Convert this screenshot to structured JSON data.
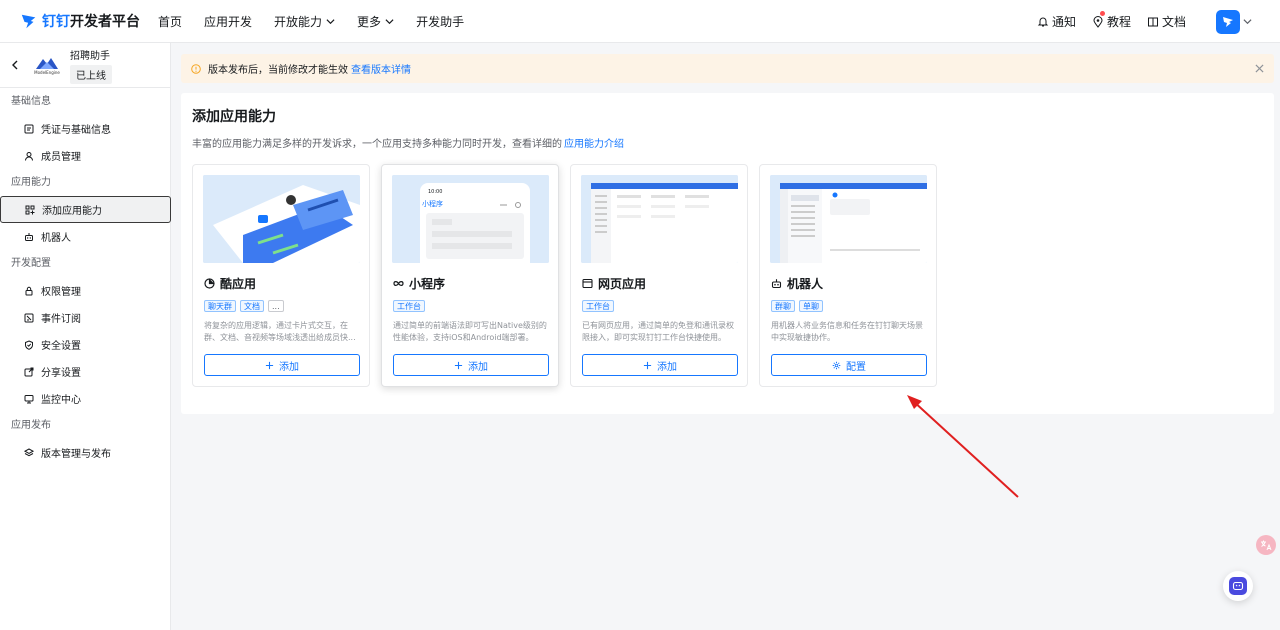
{
  "brand": {
    "name_part1": "钉钉",
    "name_part2": "开发者平台",
    "logo_icon": "dingtalk-logo-icon"
  },
  "nav": {
    "items": [
      {
        "label": "首页",
        "has_dropdown": false
      },
      {
        "label": "应用开发",
        "has_dropdown": false
      },
      {
        "label": "开放能力",
        "has_dropdown": true
      },
      {
        "label": "更多",
        "has_dropdown": true
      },
      {
        "label": "开发助手",
        "has_dropdown": false
      }
    ]
  },
  "top_right": {
    "notify_label": "通知",
    "tutorial_label": "教程",
    "docs_label": "文档"
  },
  "sidebar": {
    "app": {
      "name": "招聘助手",
      "status": "已上线",
      "logo_text": "ModelEngine"
    },
    "groups": [
      {
        "label": "基础信息",
        "items": [
          {
            "label": "凭证与基础信息",
            "icon": "list-icon"
          },
          {
            "label": "成员管理",
            "icon": "user-icon"
          }
        ]
      },
      {
        "label": "应用能力",
        "items": [
          {
            "label": "添加应用能力",
            "icon": "apps-icon",
            "active": true
          },
          {
            "label": "机器人",
            "icon": "robot-icon"
          }
        ]
      },
      {
        "label": "开发配置",
        "items": [
          {
            "label": "权限管理",
            "icon": "lock-icon"
          },
          {
            "label": "事件订阅",
            "icon": "event-icon"
          },
          {
            "label": "安全设置",
            "icon": "shield-icon"
          },
          {
            "label": "分享设置",
            "icon": "share-icon"
          },
          {
            "label": "监控中心",
            "icon": "monitor-icon"
          }
        ]
      },
      {
        "label": "应用发布",
        "items": [
          {
            "label": "版本管理与发布",
            "icon": "layers-icon"
          }
        ]
      }
    ]
  },
  "notice": {
    "text": "版本发布后，当前修改才能生效",
    "link": "查看版本详情"
  },
  "main": {
    "title": "添加应用能力",
    "desc": "丰富的应用能力满足多样的开发诉求，一个应用支持多种能力同时开发，查看详细的",
    "desc_link": "应用能力介绍",
    "cards": [
      {
        "title": "酷应用",
        "icon": "cool-app-icon",
        "tags": [
          "聊天群",
          "文档",
          "..."
        ],
        "desc": "将复杂的应用逻辑，通过卡片式交互，在群、文档、音视频等场域浅透出给成员快...",
        "button": "添加",
        "button_icon": "plus-icon"
      },
      {
        "title": "小程序",
        "icon": "mini-program-icon",
        "tags": [
          "工作台"
        ],
        "desc": "通过简单的前端语法即可写出Native级别的性能体验，支持iOS和Android端部署。",
        "button": "添加",
        "button_icon": "plus-icon",
        "hovered": true,
        "preview_time": "10:00",
        "preview_title": "小程序"
      },
      {
        "title": "网页应用",
        "icon": "web-app-icon",
        "tags": [
          "工作台"
        ],
        "desc": "已有网页应用，通过简单的免登和通讯录权限接入，即可实现钉钉工作台快捷使用。",
        "button": "添加",
        "button_icon": "plus-icon"
      },
      {
        "title": "机器人",
        "icon": "robot-icon",
        "tags": [
          "群聊",
          "单聊"
        ],
        "desc": "用机器人将业务信息和任务在钉钉聊天场景中实现敏捷协作。",
        "button": "配置",
        "button_icon": "gear-icon"
      }
    ]
  },
  "colors": {
    "accent": "#1677ff",
    "notice_bg": "#fdf3e6",
    "annotation": "#e02020"
  }
}
